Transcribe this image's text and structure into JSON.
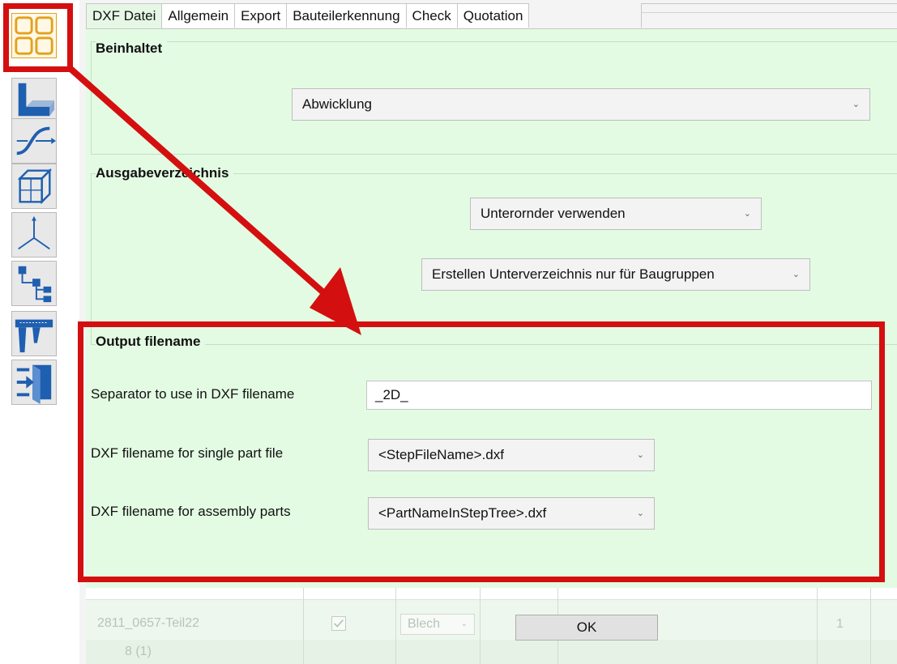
{
  "toolbar": {
    "items": [
      {
        "icon": "grid-layout-icon",
        "active": true
      },
      {
        "icon": "sheet-metal-icon"
      },
      {
        "icon": "curve-icon"
      },
      {
        "icon": "wireframe-box-icon"
      },
      {
        "icon": "coordinate-axes-icon"
      },
      {
        "icon": "tree-structure-icon"
      },
      {
        "icon": "caliper-icon"
      },
      {
        "icon": "exit-door-icon"
      }
    ],
    "accent": "#e3a11a"
  },
  "tabs": [
    "DXF Datei",
    "Allgemein",
    "Export",
    "Bauteilerkennung",
    "Check",
    "Quotation"
  ],
  "beinhaltet": {
    "title": "Beinhaltet",
    "value": "Abwicklung"
  },
  "ausgabe": {
    "title": "Ausgabeverzeichnis",
    "folder_mode": "Unterornder verwenden",
    "subdir_mode": "Erstellen Unterverzeichnis nur für Baugruppen"
  },
  "output": {
    "title": "Output filename",
    "separator_label": "Separator to use in DXF filename",
    "separator_value": "_2D_",
    "single_label": "DXF filename for single part file",
    "single_value": "<StepFileName>.dxf",
    "assembly_label": "DXF filename for assembly parts",
    "assembly_value": "<PartNameInStepTree>.dxf"
  },
  "table": {
    "part_name": "2811_0657-Teil22",
    "material": "Blech",
    "quantity": "1",
    "group_label": "8 (1)"
  },
  "ok_label": "OK",
  "colors": {
    "highlight": "#d40f0f",
    "panel": "#e3fbe3"
  }
}
